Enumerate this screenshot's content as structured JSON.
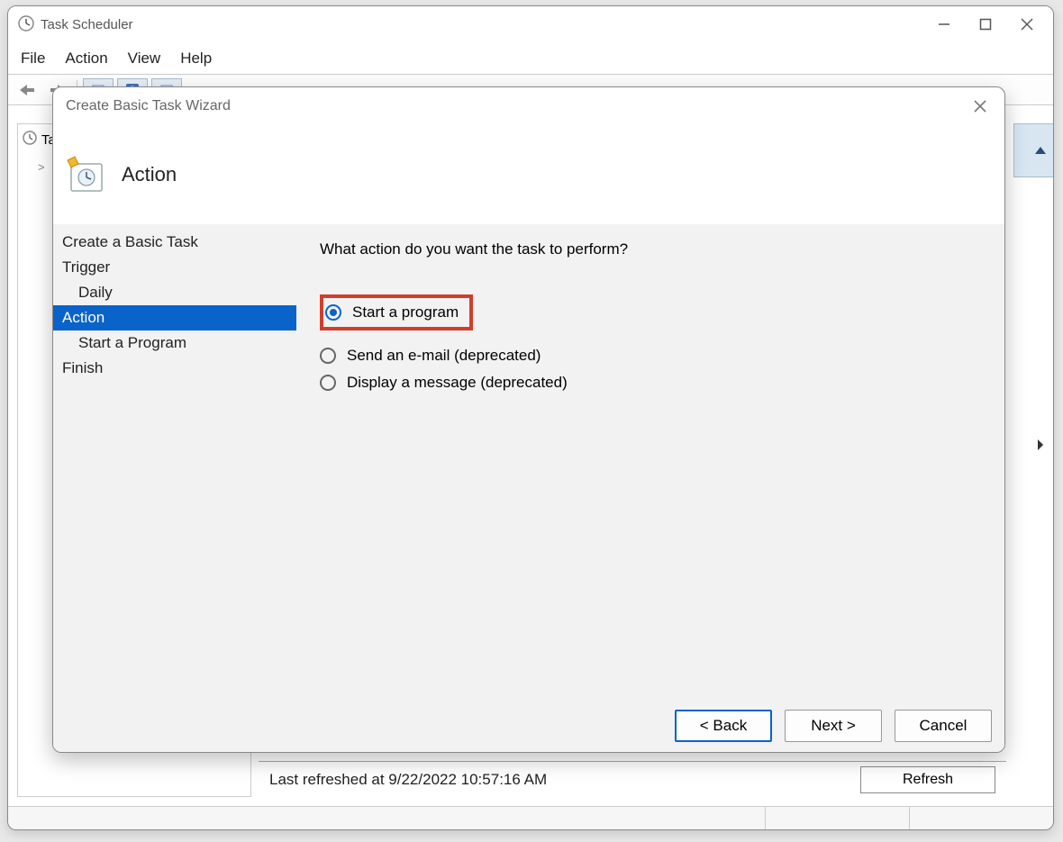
{
  "app": {
    "title": "Task Scheduler",
    "menu": {
      "file": "File",
      "action": "Action",
      "view": "View",
      "help": "Help"
    },
    "tree": {
      "root_label": "Ta",
      "child_prefix": ">"
    },
    "status_text": "Last refreshed at 9/22/2022 10:57:16 AM",
    "refresh_label": "Refresh"
  },
  "wizard": {
    "title": "Create Basic Task Wizard",
    "header": "Action",
    "nav": {
      "create": "Create a Basic Task",
      "trigger": "Trigger",
      "trigger_sub": "Daily",
      "action": "Action",
      "action_sub": "Start a Program",
      "finish": "Finish"
    },
    "prompt": "What action do you want the task to perform?",
    "options": {
      "start": "Start a program",
      "email": "Send an e-mail (deprecated)",
      "message": "Display a message (deprecated)"
    },
    "buttons": {
      "back": "< Back",
      "next": "Next >",
      "cancel": "Cancel"
    }
  }
}
